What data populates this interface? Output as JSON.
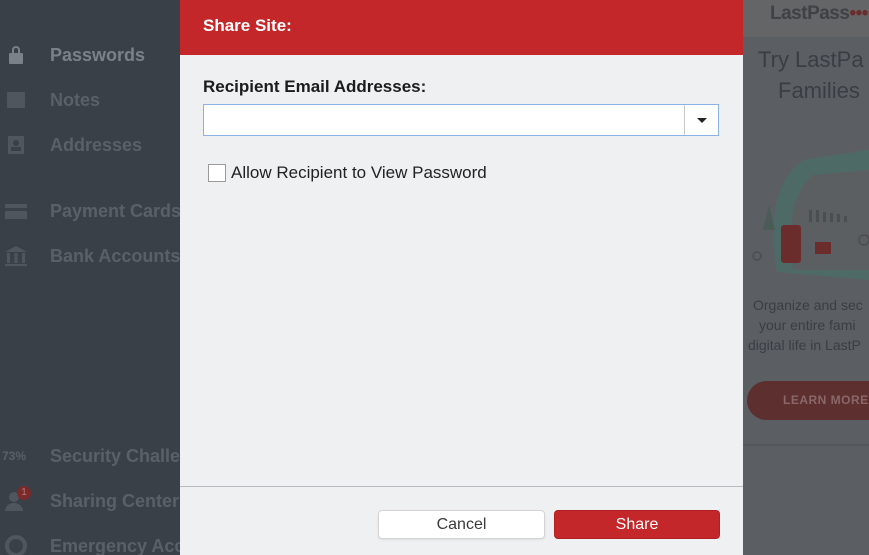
{
  "sidebar": {
    "items": [
      {
        "label": "Passwords",
        "icon": "lock-icon"
      },
      {
        "label": "Notes",
        "icon": "note-icon"
      },
      {
        "label": "Addresses",
        "icon": "address-card-icon"
      },
      {
        "label": "Payment Cards",
        "icon": "credit-card-icon"
      },
      {
        "label": "Bank Accounts",
        "icon": "bank-icon"
      },
      {
        "label": "Security Challe",
        "icon": "score-icon",
        "score": "73%"
      },
      {
        "label": "Sharing Center",
        "icon": "people-icon",
        "badge": "1"
      },
      {
        "label": "Emergency Acc",
        "icon": "lifebuoy-icon"
      }
    ]
  },
  "promo": {
    "logo_text": "LastPass",
    "logo_dots": "•••|",
    "title_line1": "Try LastPa",
    "title_line2": "Families",
    "text_line1": "Organize and sec",
    "text_line2": "your entire fami",
    "text_line3": "digital life in LastP",
    "button_label": "LEARN MORE"
  },
  "dialog": {
    "title": "Share Site:",
    "recipient_label": "Recipient Email Addresses:",
    "recipient_value": "",
    "recipient_placeholder": "",
    "allow_view_label": "Allow Recipient to View Password",
    "allow_view_checked": false,
    "cancel_label": "Cancel",
    "share_label": "Share"
  },
  "colors": {
    "accent": "#c3272a",
    "dialog_bg": "#eff0f2",
    "input_focus_border": "#8bb2e6"
  }
}
